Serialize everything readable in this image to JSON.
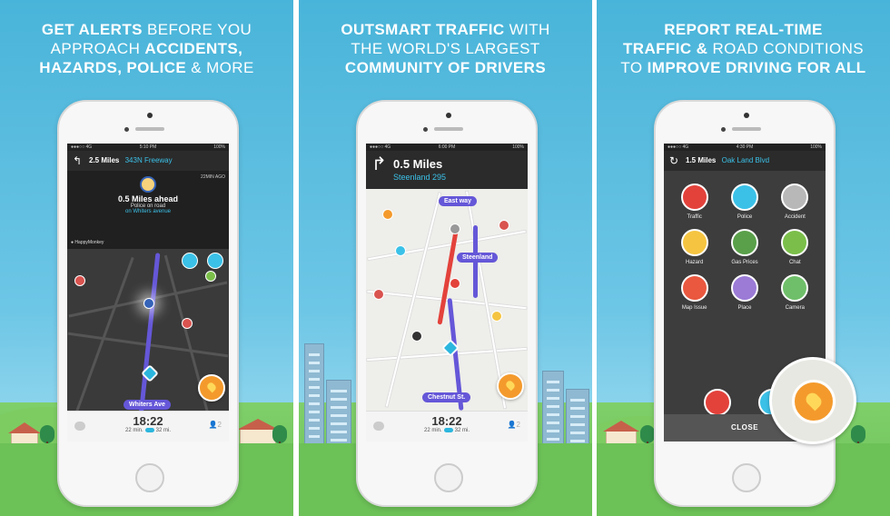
{
  "panels": [
    {
      "headline": {
        "l1a": "GET ALERTS",
        "l1b": " BEFORE YOU",
        "l2a": "APPROACH ",
        "l2b": "ACCIDENTS,",
        "l3a": "HAZARDS, POLICE",
        "l3b": " & MORE"
      },
      "status": {
        "carrier": "●●●○○ 4G",
        "time": "5:10 PM",
        "battery": "100%"
      },
      "nav": {
        "distance": "2.5 Miles",
        "street": "343N Freeway"
      },
      "alert": {
        "ago": "22MIN AGO",
        "title": "0.5 Miles ahead",
        "subtitle": "Police on road",
        "location": "on Whiters avenue",
        "user": "HappyMonkey"
      },
      "street_pill": "Whiters Ave",
      "eta": {
        "time": "18:22",
        "duration": "22 min.",
        "distance": "32 mi."
      },
      "people_count": "2"
    },
    {
      "headline": {
        "l1a": "OUTSMART TRAFFIC",
        "l1b": " WITH",
        "l2": "THE WORLD'S LARGEST",
        "l3": "COMMUNITY OF DRIVERS"
      },
      "status": {
        "carrier": "●●●○○ 4G",
        "time": "6:00 PM",
        "battery": "100%"
      },
      "nav": {
        "distance": "0.5 Miles",
        "street": "Steenland 295"
      },
      "pills": {
        "east": "East way",
        "steenland": "Steenland",
        "chestnut": "Chestnut St."
      },
      "eta": {
        "time": "18:22",
        "duration": "22 min.",
        "distance": "32 mi."
      },
      "people_count": "2"
    },
    {
      "headline": {
        "l1": "REPORT REAL-TIME",
        "l2a": "TRAFFIC & ",
        "l2b": "ROAD CONDITIONS",
        "l3a": "TO ",
        "l3b": "IMPROVE DRIVING FOR ALL"
      },
      "status": {
        "carrier": "●●●○○ 4G",
        "time": "4:30 PM",
        "battery": "100%"
      },
      "nav": {
        "distance": "1.5 Miles",
        "street": "Oak Land Blvd"
      },
      "report_items": [
        "Traffic",
        "Police",
        "Accident",
        "Hazard",
        "Gas Prices",
        "Chat",
        "Map Issue",
        "Place",
        "Camera"
      ],
      "close_label": "CLOSE"
    }
  ],
  "colors": {
    "sky": "#49b4d9",
    "grass": "#6cc157",
    "route": "#6557d8",
    "accent": "#3bc1e8",
    "fab": "#f49a2c"
  }
}
